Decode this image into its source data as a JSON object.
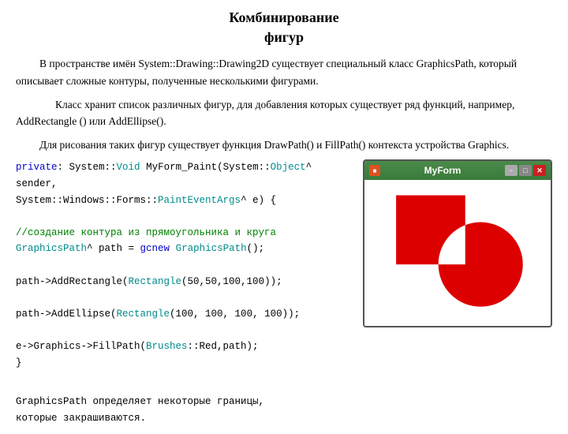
{
  "page": {
    "title_line1": "Комбинирование",
    "title_line2": "фигур",
    "para1": "В пространстве имён System::Drawing::Drawing2D существует специальный класс GraphicsPath, который описывает сложные контуры, полученные несколькими фигурами.",
    "para2": "Класс хранит список различных фигур, для добавления которых существует ряд функций, например, AddRectangle () или AddEllipse().",
    "para3": "Для рисования таких фигур существует функция DrawPath() и FillPath() контекста устройства Graphics.",
    "window_title": "MyForm",
    "footer1": "GraphicsPath определяет некоторые границы,",
    "footer2": "которые закрашиваются."
  },
  "code": {
    "line1_kw": "private",
    "line1_type": "Void",
    "line1_method": "MyForm_Paint",
    "line1_type2": "Object",
    "line1_param1": "sender,",
    "line2_ns1": "System::Windows::Forms::",
    "line2_type": "PaintEventArgs",
    "line2_param": "e) {",
    "blank1": "",
    "comment": "//создание контура из прямоугольника и круга",
    "line3_type": "GraphicsPath",
    "line3_var": "path",
    "line3_kw": "gcnew",
    "line3_type2": "GraphicsPath",
    "blank2": "",
    "line4": "path->AddRectangle(",
    "line4_type": "Rectangle",
    "line4_args": "(50,50,100,100));",
    "blank3": "",
    "line5": "path->AddEllipse(",
    "line5_type": "Rectangle",
    "line5_args": "(100, 100, 100, 100));",
    "blank4": "",
    "line6_var": "e->Graphics->FillPath(",
    "line6_type": "Brushes",
    "line6_rest": "::Red,path);",
    "line6_close": "}",
    "blank5": ""
  },
  "icons": {
    "minimize": "−",
    "maximize": "□",
    "close": "✕"
  }
}
